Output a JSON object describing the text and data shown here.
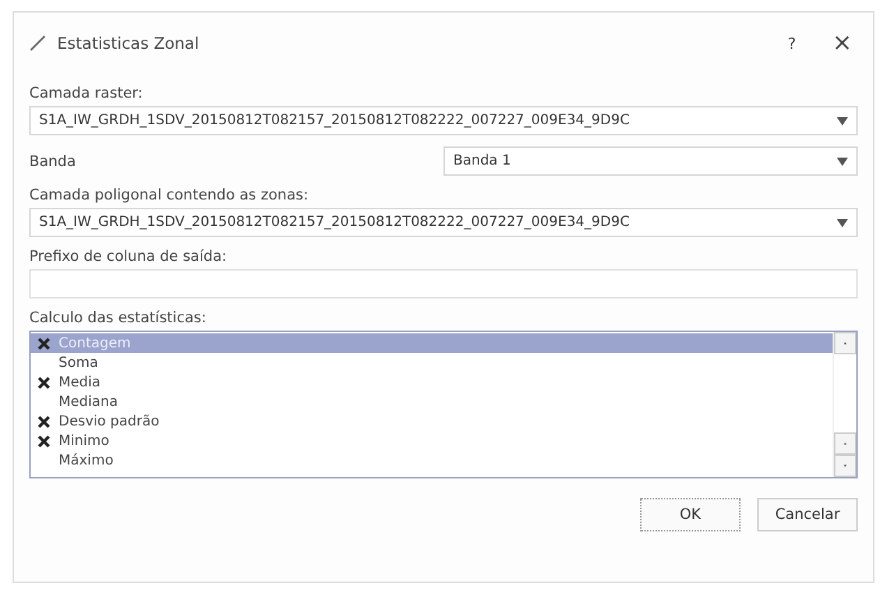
{
  "window": {
    "title": "Estatisticas Zonal",
    "help": "?",
    "close": "×"
  },
  "raster_layer": {
    "label": "Camada raster:",
    "value": "S1A_IW_GRDH_1SDV_20150812T082157_20150812T082222_007227_009E34_9D9C"
  },
  "band": {
    "label": "Banda",
    "value": "Banda 1"
  },
  "polygon_layer": {
    "label": "Camada poligonal contendo as zonas:",
    "value": "S1A_IW_GRDH_1SDV_20150812T082157_20150812T082222_007227_009E34_9D9C"
  },
  "prefix": {
    "label": "Prefixo de coluna de saída:"
  },
  "statistics": {
    "label": "Calculo das estatísticas:",
    "items": [
      {
        "label": "Contagem",
        "checked": true,
        "selected": true
      },
      {
        "label": "Soma",
        "checked": false,
        "selected": false
      },
      {
        "label": "Media",
        "checked": true,
        "selected": false
      },
      {
        "label": "Mediana",
        "checked": false,
        "selected": false
      },
      {
        "label": "Desvio padrão",
        "checked": true,
        "selected": false
      },
      {
        "label": "Minimo",
        "checked": true,
        "selected": false
      },
      {
        "label": "Máximo",
        "checked": false,
        "selected": false
      }
    ]
  },
  "buttons": [
    {
      "label": "OK"
    },
    {
      "label": "Cancelar"
    }
  ]
}
